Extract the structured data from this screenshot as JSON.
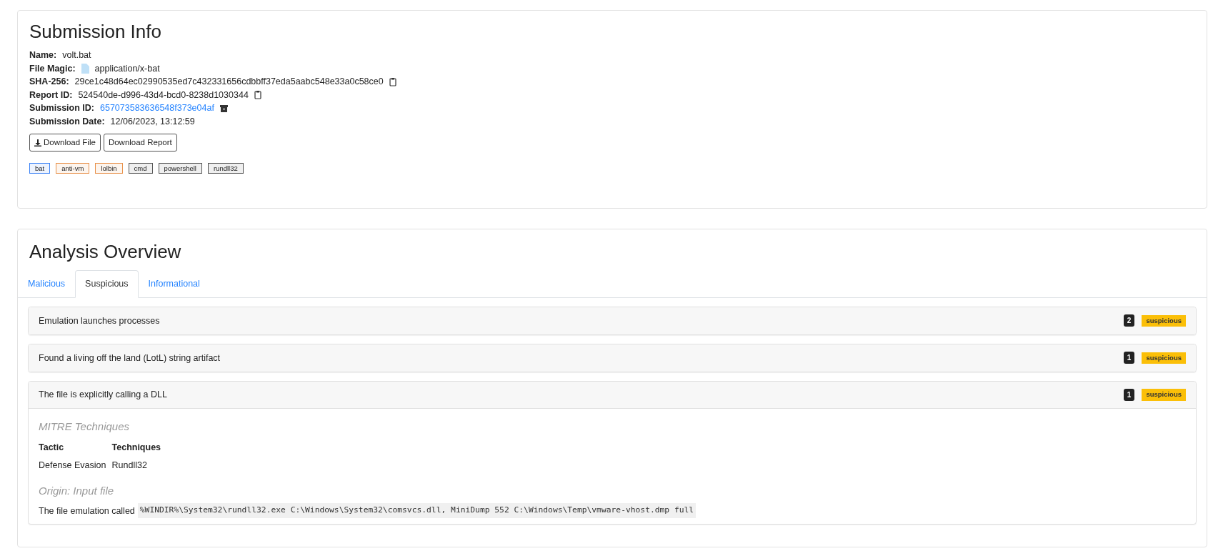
{
  "submission_info": {
    "title": "Submission Info",
    "fields": [
      {
        "label": "Name:",
        "value": "volt.bat",
        "kind": "plain"
      },
      {
        "label": "File Magic:",
        "value": "application/x-bat",
        "kind": "file"
      },
      {
        "label": "SHA-256:",
        "value": "29ce1c48d64ec02990535ed7c432331656cdbbff37eda5aabc548e33a0c58ce0",
        "kind": "copy"
      },
      {
        "label": "Report ID:",
        "value": "524540de-d996-43d4-bcd0-8238d1030344",
        "kind": "copy"
      },
      {
        "label": "Submission ID:",
        "value": "657073583636548f373e04af",
        "kind": "link"
      },
      {
        "label": "Submission Date:",
        "value": "12/06/2023, 13:12:59",
        "kind": "plain"
      }
    ],
    "buttons": [
      {
        "label": "Download File",
        "kind": "download"
      },
      {
        "label": "Download Report",
        "kind": "plain"
      }
    ],
    "tags": [
      {
        "label": "bat",
        "color": "#3b82f6"
      },
      {
        "label": "anti-vm",
        "color": "#e8914a"
      },
      {
        "label": "lolbin",
        "color": "#e8914a"
      },
      {
        "label": "cmd",
        "color": "#555555"
      },
      {
        "label": "powershell",
        "color": "#555555"
      },
      {
        "label": "rundll32",
        "color": "#555555"
      }
    ]
  },
  "analysis_overview": {
    "title": "Analysis Overview",
    "tabs": [
      {
        "label": "Malicious",
        "selected": false
      },
      {
        "label": "Suspicious",
        "selected": true
      },
      {
        "label": "Informational",
        "selected": false
      }
    ],
    "items": [
      {
        "title": "Emulation launches processes",
        "count": "2",
        "badge": "suspicious",
        "expanded": false
      },
      {
        "title": "Found a living off the land (LotL) string artifact",
        "count": "1",
        "badge": "suspicious",
        "expanded": false
      },
      {
        "title": "The file is explicitly calling a DLL",
        "count": "1",
        "badge": "suspicious",
        "expanded": true,
        "details": {
          "mitre_heading": "MITRE Techniques",
          "columns": [
            "Tactic",
            "Techniques"
          ],
          "rows": [
            [
              "Defense Evasion",
              "Rundll32"
            ]
          ],
          "origin_heading": "Origin: Input file",
          "text": "The file emulation called",
          "code": "%WINDIR%\\System32\\rundll32.exe C:\\Windows\\System32\\comsvcs.dll, MiniDump 552 C:\\Windows\\Temp\\vmware-vhost.dmp full"
        }
      }
    ]
  }
}
